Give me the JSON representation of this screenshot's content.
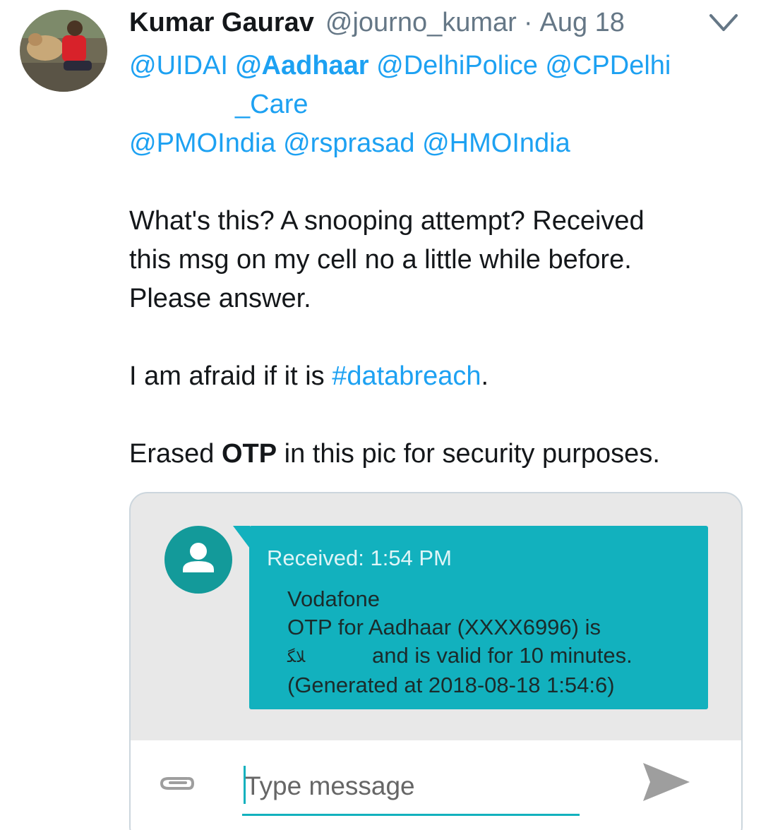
{
  "tweet": {
    "author_name": "Kumar Gaurav",
    "handle": "@journo_kumar",
    "separator": "·",
    "date": "Aug 18",
    "mentions_line1": [
      "@UIDAI",
      "@Aadhaar",
      "@DelhiPolice",
      "@CPDelhi"
    ],
    "mentions_line2": "_Care",
    "mentions_line3": [
      "@PMOIndia",
      "@rsprasad",
      "@HMOIndia"
    ],
    "body_line1": "What's this? A snooping attempt? Received",
    "body_line2": "this msg on my cell no a little while before.",
    "body_line3": "Please answer.",
    "afraid_prefix": "I am afraid if it is ",
    "hashtag": "#databreach",
    "afraid_suffix": ".",
    "erased_prefix": "Erased ",
    "erased_bold": "OTP",
    "erased_suffix": " in this pic for security purposes."
  },
  "sms": {
    "received": "Received: 1:54 PM",
    "line1": "Vodafone",
    "line2": "OTP for Aadhaar (XXXX6996) is",
    "redacted_scribble": "ﻼﮕ",
    "line3_rest": "and is valid for 10 minutes.",
    "line4": "(Generated at 2018-08-18 1:54:6)",
    "placeholder": "Type message"
  },
  "colors": {
    "link": "#1da1f2",
    "bubble": "#12b1be",
    "contact_avatar": "#139a9a",
    "muted": "#657786"
  },
  "icons": [
    "chevron-down-icon",
    "person-icon",
    "paperclip-icon",
    "send-icon"
  ]
}
